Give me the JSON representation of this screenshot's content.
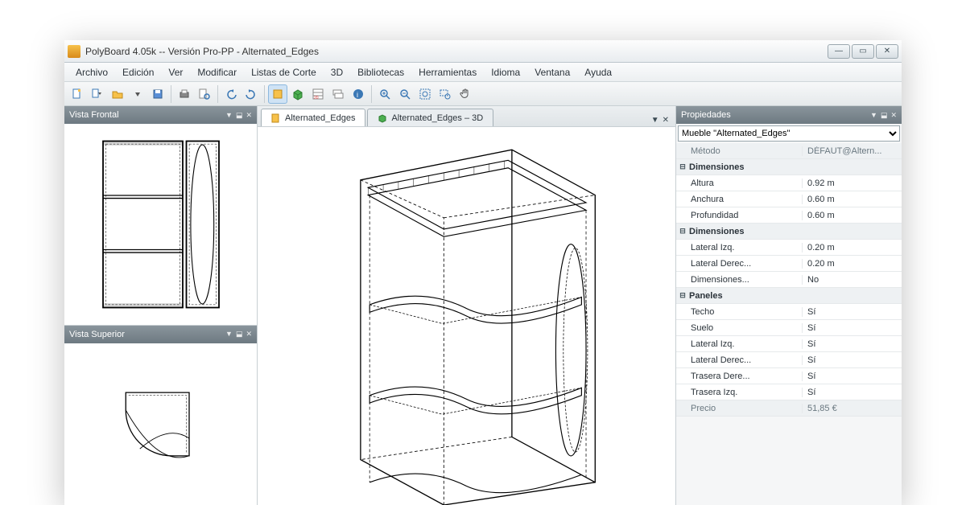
{
  "window": {
    "title": "PolyBoard 4.05k -- Versión Pro-PP - Alternated_Edges"
  },
  "menu": {
    "items": [
      "Archivo",
      "Edición",
      "Ver",
      "Modificar",
      "Listas de Corte",
      "3D",
      "Bibliotecas",
      "Herramientas",
      "Idioma",
      "Ventana",
      "Ayuda"
    ]
  },
  "panels": {
    "front": "Vista Frontal",
    "top": "Vista Superior",
    "props": "Propiedades"
  },
  "tabs": {
    "t1": "Alternated_Edges",
    "t2": "Alternated_Edges – 3D"
  },
  "properties": {
    "selector": "Mueble \"Alternated_Edges\"",
    "metodo_label": "Método",
    "metodo_value": "DÉFAUT@Altern...",
    "group1": "Dimensiones",
    "altura_l": "Altura",
    "altura_v": "0.92 m",
    "anchura_l": "Anchura",
    "anchura_v": "0.60 m",
    "prof_l": "Profundidad",
    "prof_v": "0.60 m",
    "group2": "Dimensiones",
    "latizq_l": "Lateral Izq.",
    "latizq_v": "0.20 m",
    "latder_l": "Lateral Derec...",
    "latder_v": "0.20 m",
    "dims_l": "Dimensiones...",
    "dims_v": "No",
    "group3": "Paneles",
    "techo_l": "Techo",
    "techo_v": "Sí",
    "suelo_l": "Suelo",
    "suelo_v": "Sí",
    "plizq_l": "Lateral Izq.",
    "plizq_v": "Sí",
    "plder_l": "Lateral Derec...",
    "plder_v": "Sí",
    "trder_l": "Trasera Dere...",
    "trder_v": "Sí",
    "trizq_l": "Trasera Izq.",
    "trizq_v": "Sí",
    "precio_l": "Precio",
    "precio_v": "51,85 €"
  }
}
